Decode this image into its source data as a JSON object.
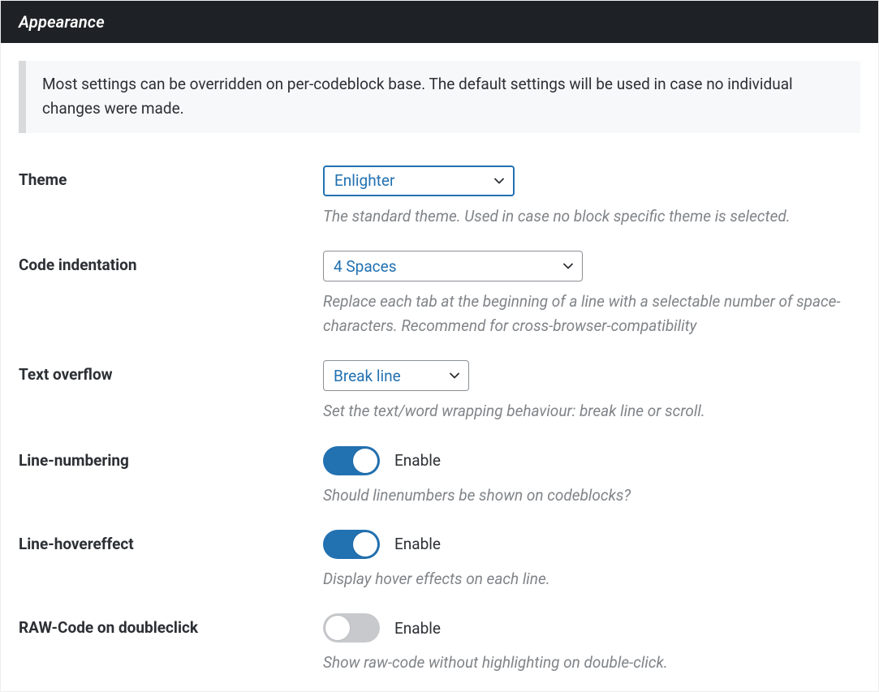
{
  "header": {
    "title": "Appearance"
  },
  "notice": "Most settings can be overridden on per-codeblock base. The default settings will be used in case no individual changes were made.",
  "settings": {
    "theme": {
      "label": "Theme",
      "value": "Enlighter",
      "desc": "The standard theme. Used in case no block specific theme is selected."
    },
    "indentation": {
      "label": "Code indentation",
      "value": "4 Spaces",
      "desc": "Replace each tab at the beginning of a line with a selectable number of space-characters. Recommend for cross-browser-compatibility"
    },
    "overflow": {
      "label": "Text overflow",
      "value": "Break line",
      "desc": "Set the text/word wrapping behaviour: break line or scroll."
    },
    "linenum": {
      "label": "Line-numbering",
      "toggle_label": "Enable",
      "on": true,
      "desc": "Should linenumbers be shown on codeblocks?"
    },
    "linehover": {
      "label": "Line-hovereffect",
      "toggle_label": "Enable",
      "on": true,
      "desc": "Display hover effects on each line."
    },
    "rawcode": {
      "label": "RAW-Code on doubleclick",
      "toggle_label": "Enable",
      "on": false,
      "desc": "Show raw-code without highlighting on double-click."
    }
  }
}
